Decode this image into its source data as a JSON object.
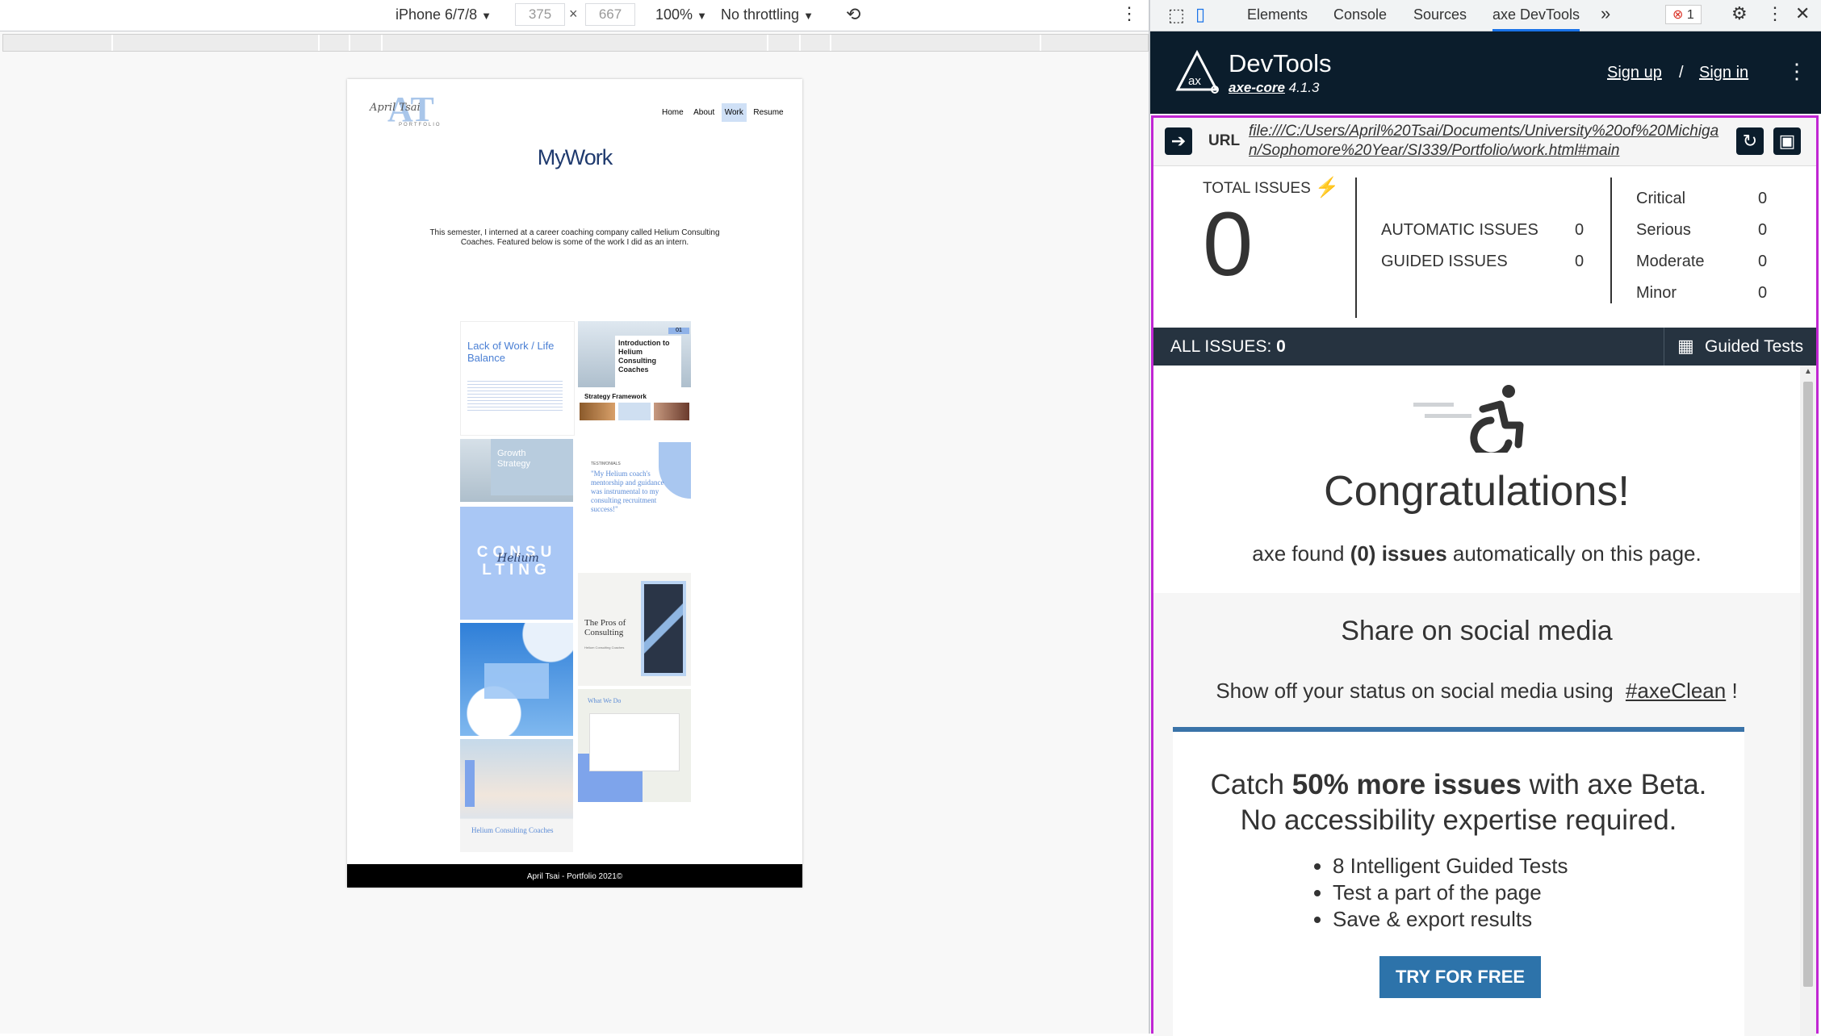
{
  "device_toolbar": {
    "device": "iPhone 6/7/8",
    "width": "375",
    "height": "667",
    "zoom": "100%",
    "throttle": "No throttling"
  },
  "website": {
    "logo_text": "April Tsai",
    "logo_monogram": "AT",
    "logo_sub": "PORTFOLIO",
    "nav": [
      "Home",
      "About",
      "Work",
      "Resume"
    ],
    "active_nav": "Work",
    "heading": "MyWork",
    "intro": "This semester, I interned at a career coaching company called Helium Consulting Coaches. Featured below is some of the work I did as an intern.",
    "tiles": {
      "lack_of_work": "Lack of Work / Life Balance",
      "intro_helium": "Introduction to Helium Consulting Coaches",
      "intro_number": "01",
      "strategy_framework": "Strategy Framework",
      "growth_strategy": "Growth Strategy",
      "testimonials_label": "TESTIMONIALS",
      "testimonial_quote": "\"My Helium coach's mentorship and guidance was instrumental to my consulting recruitment success!\"",
      "consulting": "CONSU LTING",
      "consulting_script": "Helium",
      "pros_of_consulting": "The Pros of Consulting",
      "pros_sub": "Helium Consulting Coaches",
      "what_we_do": "What We Do",
      "helium_coaches": "Helium Consulting Coaches"
    },
    "footer": "April Tsai - Portfolio 2021©"
  },
  "devtools_tabs": {
    "items": [
      "Elements",
      "Console",
      "Sources",
      "axe DevTools"
    ],
    "active": "axe DevTools",
    "more": "»",
    "error_count": "1"
  },
  "axe": {
    "title": "DevTools",
    "core_label": "axe-core",
    "core_version": "4.1.3",
    "sign_up": "Sign up",
    "separator": "/",
    "sign_in": "Sign in",
    "url_label": "URL",
    "url": "file:///C:/Users/April%20Tsai/Documents/University%20of%20Michigan/Sophomore%20Year/SI339/Portfolio/work.html#main",
    "total_issues_label": "TOTAL ISSUES",
    "total_issues": "0",
    "automatic_label": "AUTOMATIC ISSUES",
    "automatic": "0",
    "guided_label": "GUIDED ISSUES",
    "guided": "0",
    "severity": [
      {
        "label": "Critical",
        "count": "0"
      },
      {
        "label": "Serious",
        "count": "0"
      },
      {
        "label": "Moderate",
        "count": "0"
      },
      {
        "label": "Minor",
        "count": "0"
      }
    ],
    "all_issues_label": "ALL ISSUES:",
    "all_issues_count": "0",
    "guided_tests": "Guided Tests",
    "congrats": "Congratulations!",
    "found_pre": "axe found",
    "found_count": "(0)",
    "found_issues": "issues",
    "found_post": "automatically on this page.",
    "share_title": "Share on social media",
    "share_text": "Show off your status on social media using",
    "share_tag": "#axeClean",
    "share_end": "!",
    "promo_pre": "Catch",
    "promo_bold": "50% more issues",
    "promo_post": "with axe Beta.",
    "promo_line2": "No accessibility expertise required.",
    "promo_bullets": [
      "8 Intelligent Guided Tests",
      "Test a part of the page",
      "Save & export results"
    ],
    "try_free": "TRY FOR FREE"
  },
  "colors": {
    "axe_dark": "#0b1d2c",
    "issues_bar": "#263340",
    "highlight_border": "#c026d3",
    "cta_blue": "#2d73aa",
    "link_underline": "#333333"
  }
}
